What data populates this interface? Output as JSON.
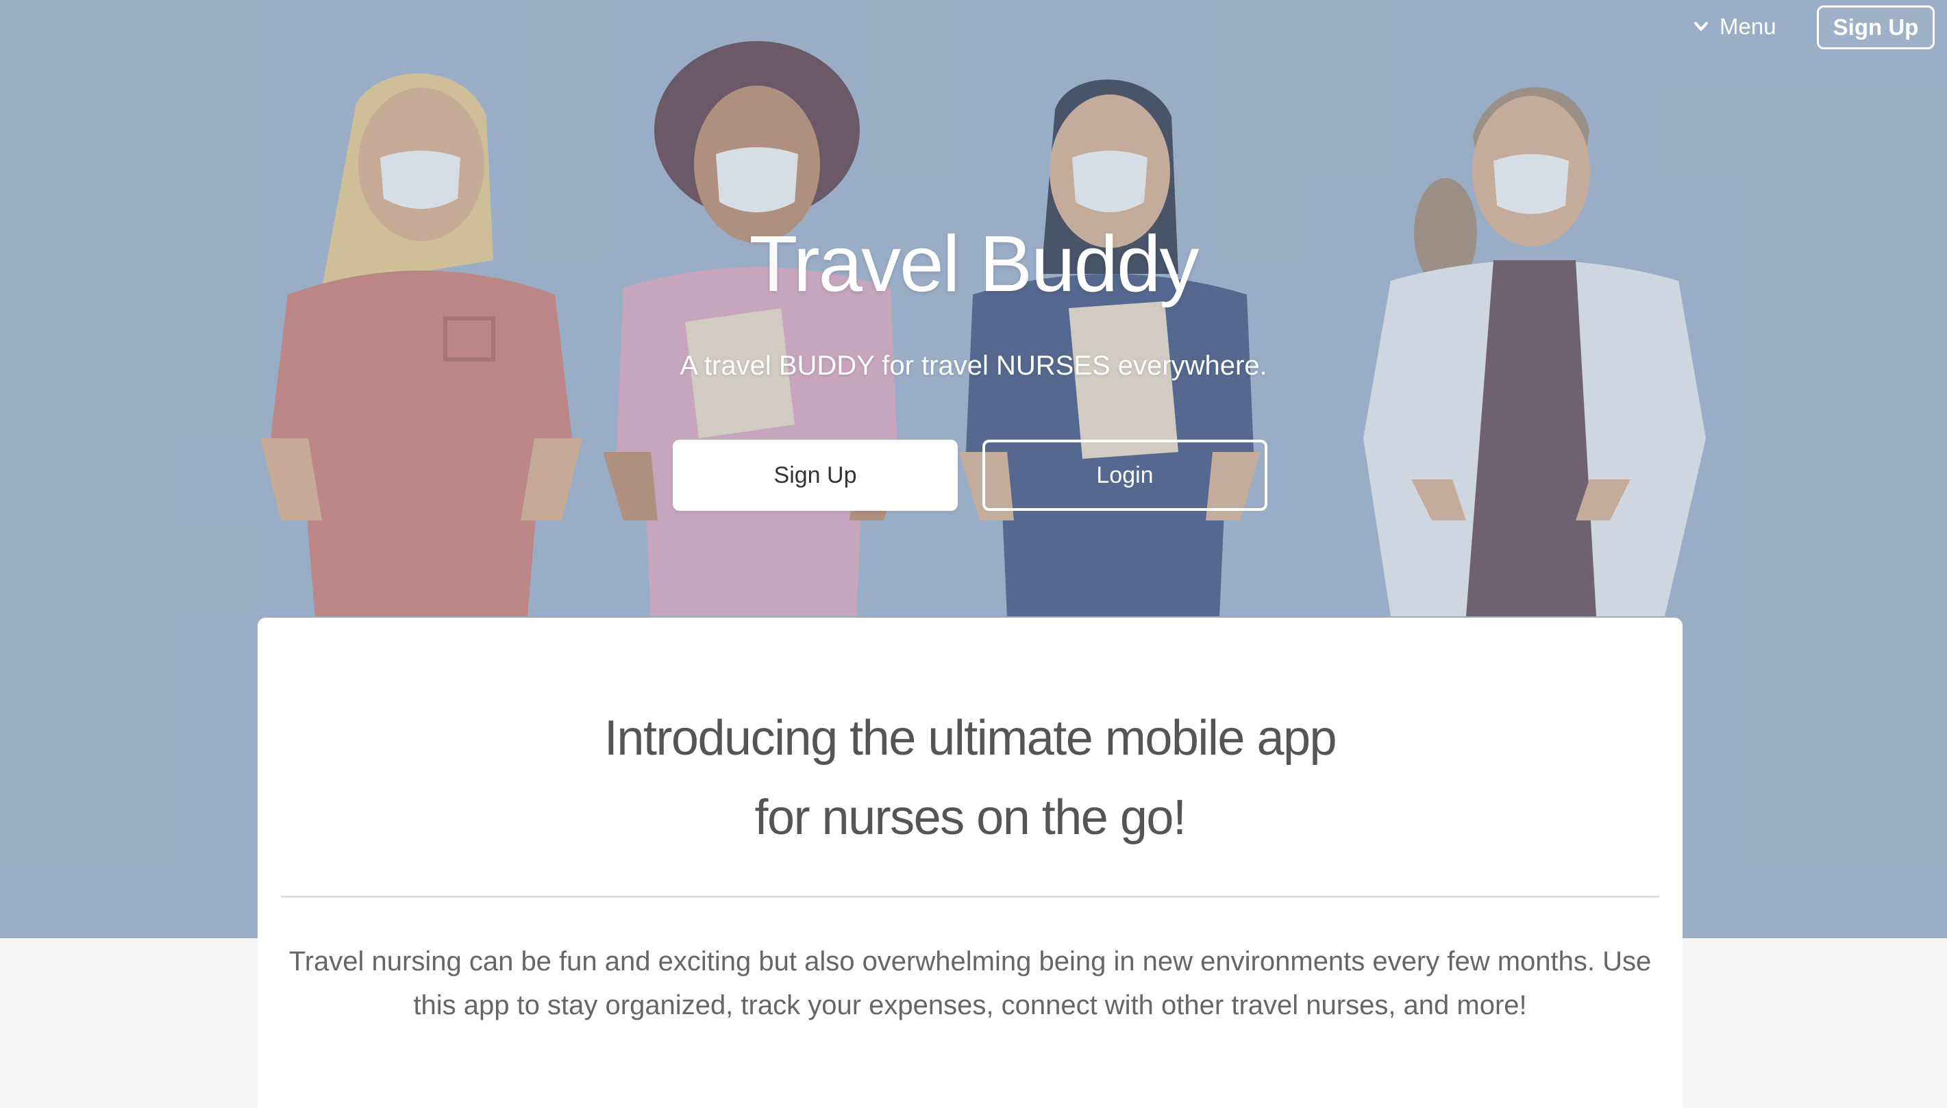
{
  "nav": {
    "menu_label": "Menu",
    "signup_label": "Sign Up"
  },
  "hero": {
    "title": "Travel Buddy",
    "subtitle": "A travel BUDDY for travel NURSES everywhere.",
    "signup_label": "Sign Up",
    "login_label": "Login",
    "illustration": "four-masked-nurses-illustration"
  },
  "intro": {
    "heading_line1": "Introducing the ultimate mobile app",
    "heading_line2": "for nurses on the go!",
    "body": "Travel nursing can be fun and exciting but also overwhelming being in new environments every few months. Use this app to stay organized, track your expenses, connect with other travel nurses, and more!"
  },
  "colors": {
    "hero_background": "#9aaec6",
    "page_background": "#f4f4f4",
    "card_background": "#ffffff",
    "heading_text": "#555555",
    "body_text": "#666666"
  },
  "icons": {
    "menu": "chevron-down-icon"
  }
}
